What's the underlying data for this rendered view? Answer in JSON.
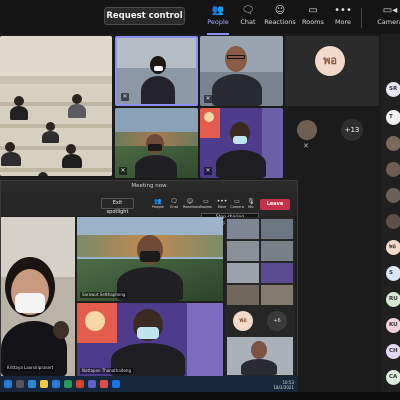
{
  "toolbar": {
    "request_control": "Request control",
    "people": "People",
    "chat": "Chat",
    "reactions": "Reactions",
    "rooms": "Rooms",
    "more": "More",
    "camera": "Camera"
  },
  "grid": {
    "avatar_initials": "พอ",
    "overflow_count": "+13"
  },
  "panel": {
    "avatars": [
      {
        "initials": "SR",
        "color": "#e6e6f5"
      },
      {
        "initials": "T",
        "color": "#f0f0f0"
      },
      {
        "initials": "",
        "color": "#7a6a5a"
      },
      {
        "initials": "",
        "color": "#6d5d52"
      },
      {
        "initials": "",
        "color": "#6a6058"
      },
      {
        "initials": "",
        "color": "#5c5048"
      },
      {
        "initials": "พอ",
        "color": "#f2d9c9"
      },
      {
        "initials": "S",
        "color": "#d9e7f5"
      },
      {
        "initials": "RU",
        "color": "#d6e7d2"
      },
      {
        "initials": "KU",
        "color": "#f0d2dc"
      },
      {
        "initials": "CH",
        "color": "#e2d8ef"
      },
      {
        "initials": "CA",
        "color": "#dcebdc"
      }
    ]
  },
  "inner": {
    "title": "Meeting now",
    "exit_spotlight": "Exit spotlight",
    "tools": [
      "People",
      "Chat",
      "Reactions",
      "Rooms",
      "More",
      "Camera",
      "Mic",
      "Share"
    ],
    "leave": "Leave",
    "tooltip": "Stop sharing (Ctrl+Shift+E)",
    "name_main": "Krittaya Laorsiriprasert",
    "name_center": "Sarawut Setthaphong",
    "name_bottom": "Nattapon Thanathaitong",
    "avatar_initials": "พอ",
    "overflow_count": "+6"
  },
  "taskbar": {
    "time": "10:53",
    "date": "18/3/2021"
  }
}
